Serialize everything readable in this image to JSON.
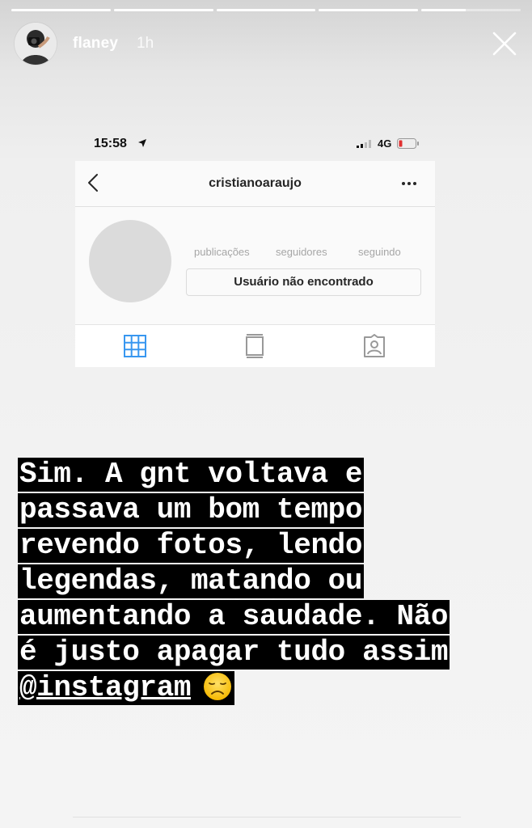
{
  "progress": [
    1,
    1,
    1,
    1,
    0.45
  ],
  "story": {
    "username": "flaney",
    "time_ago": "1h",
    "avatar_icon": "user-photo-avatar",
    "close_icon": "close-icon"
  },
  "screenshot": {
    "status_bar": {
      "time": "15:58",
      "network": "4G",
      "battery_color": "#e03131"
    },
    "nav": {
      "title": "cristianoaraujo"
    },
    "profile": {
      "stats": [
        "publicações",
        "seguidores",
        "seguindo"
      ],
      "button_label": "Usuário não encontrado"
    },
    "tabs": {
      "active": "grid",
      "active_color": "#3897f0",
      "inactive_color": "#999999"
    }
  },
  "caption": {
    "lines": [
      "Sim. A gnt voltava e",
      "passava um bom tempo",
      "revendo fotos, lendo",
      "legendas, matando ou",
      "aumentando a saudade. Não",
      "é justo apagar tudo assim"
    ],
    "mention": "@instagram",
    "emoji": "disappointed-face"
  }
}
